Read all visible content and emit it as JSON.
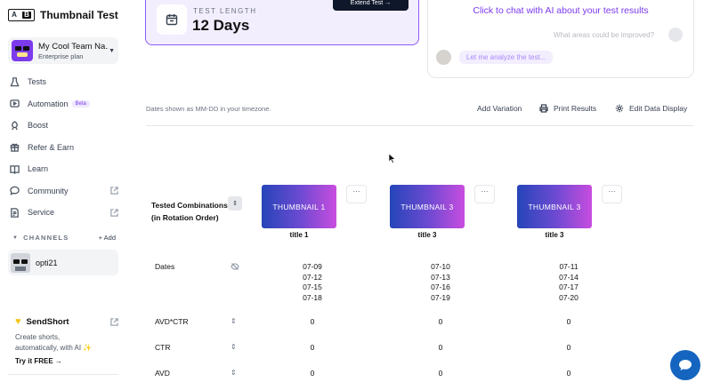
{
  "app": {
    "logo_left": "A",
    "logo_right": "B",
    "title": "Thumbnail Test"
  },
  "team": {
    "name": "My Cool Team Na...",
    "plan": "Enterprise plan"
  },
  "nav": [
    {
      "label": "Tests",
      "icon": "beaker-icon"
    },
    {
      "label": "Automation",
      "icon": "play-icon",
      "badge": "Beta"
    },
    {
      "label": "Boost",
      "icon": "rocket-icon"
    },
    {
      "label": "Refer & Earn",
      "icon": "gift-icon"
    },
    {
      "label": "Learn",
      "icon": "book-icon"
    },
    {
      "label": "Community",
      "icon": "chat-icon"
    },
    {
      "label": "Service",
      "icon": "service-icon"
    }
  ],
  "channels": {
    "heading": "CHANNELS",
    "add_label": "+ Add",
    "items": [
      {
        "name": "opti21"
      }
    ]
  },
  "promo": {
    "title": "SendShort",
    "text": "Create shorts, automatically, with AI ✨",
    "cta": "Try it FREE →"
  },
  "test_length": {
    "label": "TEST LENGTH",
    "value": "12 Days",
    "extend_button": "Extend Test →"
  },
  "chat_panel": {
    "title": "Click to chat with AI about your test results",
    "user_question": "What areas could be improved?",
    "ai_response": "Let me analyze the test..."
  },
  "toolbar": {
    "timezone_note": "Dates shown as MM-DD in your timezone.",
    "add_variation": "Add Variation",
    "print_results": "Print Results",
    "edit_display": "Edit Data Display"
  },
  "table": {
    "tested_label_line1": "Tested Combinations:",
    "tested_label_line2": "(in Rotation Order)",
    "columns": [
      {
        "thumbnail": "THUMBNAIL 1",
        "title": "title 1",
        "dates": [
          "07-09",
          "07-12",
          "07-15",
          "07-18"
        ],
        "avd_ctr": "0",
        "ctr": "0",
        "avd": "0"
      },
      {
        "thumbnail": "THUMBNAIL 3",
        "title": "title 3",
        "dates": [
          "07-10",
          "07-13",
          "07-16",
          "07-19"
        ],
        "avd_ctr": "0",
        "ctr": "0",
        "avd": "0"
      },
      {
        "thumbnail": "THUMBNAIL 3",
        "title": "title 3",
        "dates": [
          "07-11",
          "07-14",
          "07-17",
          "07-20"
        ],
        "avd_ctr": "0",
        "ctr": "0",
        "avd": "0"
      }
    ],
    "row_labels": {
      "dates": "Dates",
      "avd_ctr": "AVD*CTR",
      "ctr": "CTR",
      "avd": "AVD"
    }
  },
  "more_label": "···",
  "sort_glyph": "⇕",
  "colors": {
    "accent": "#7c3aed",
    "thumb_start": "#2545b8",
    "thumb_end": "#c84ddf",
    "chat_fab": "#1565c0"
  }
}
